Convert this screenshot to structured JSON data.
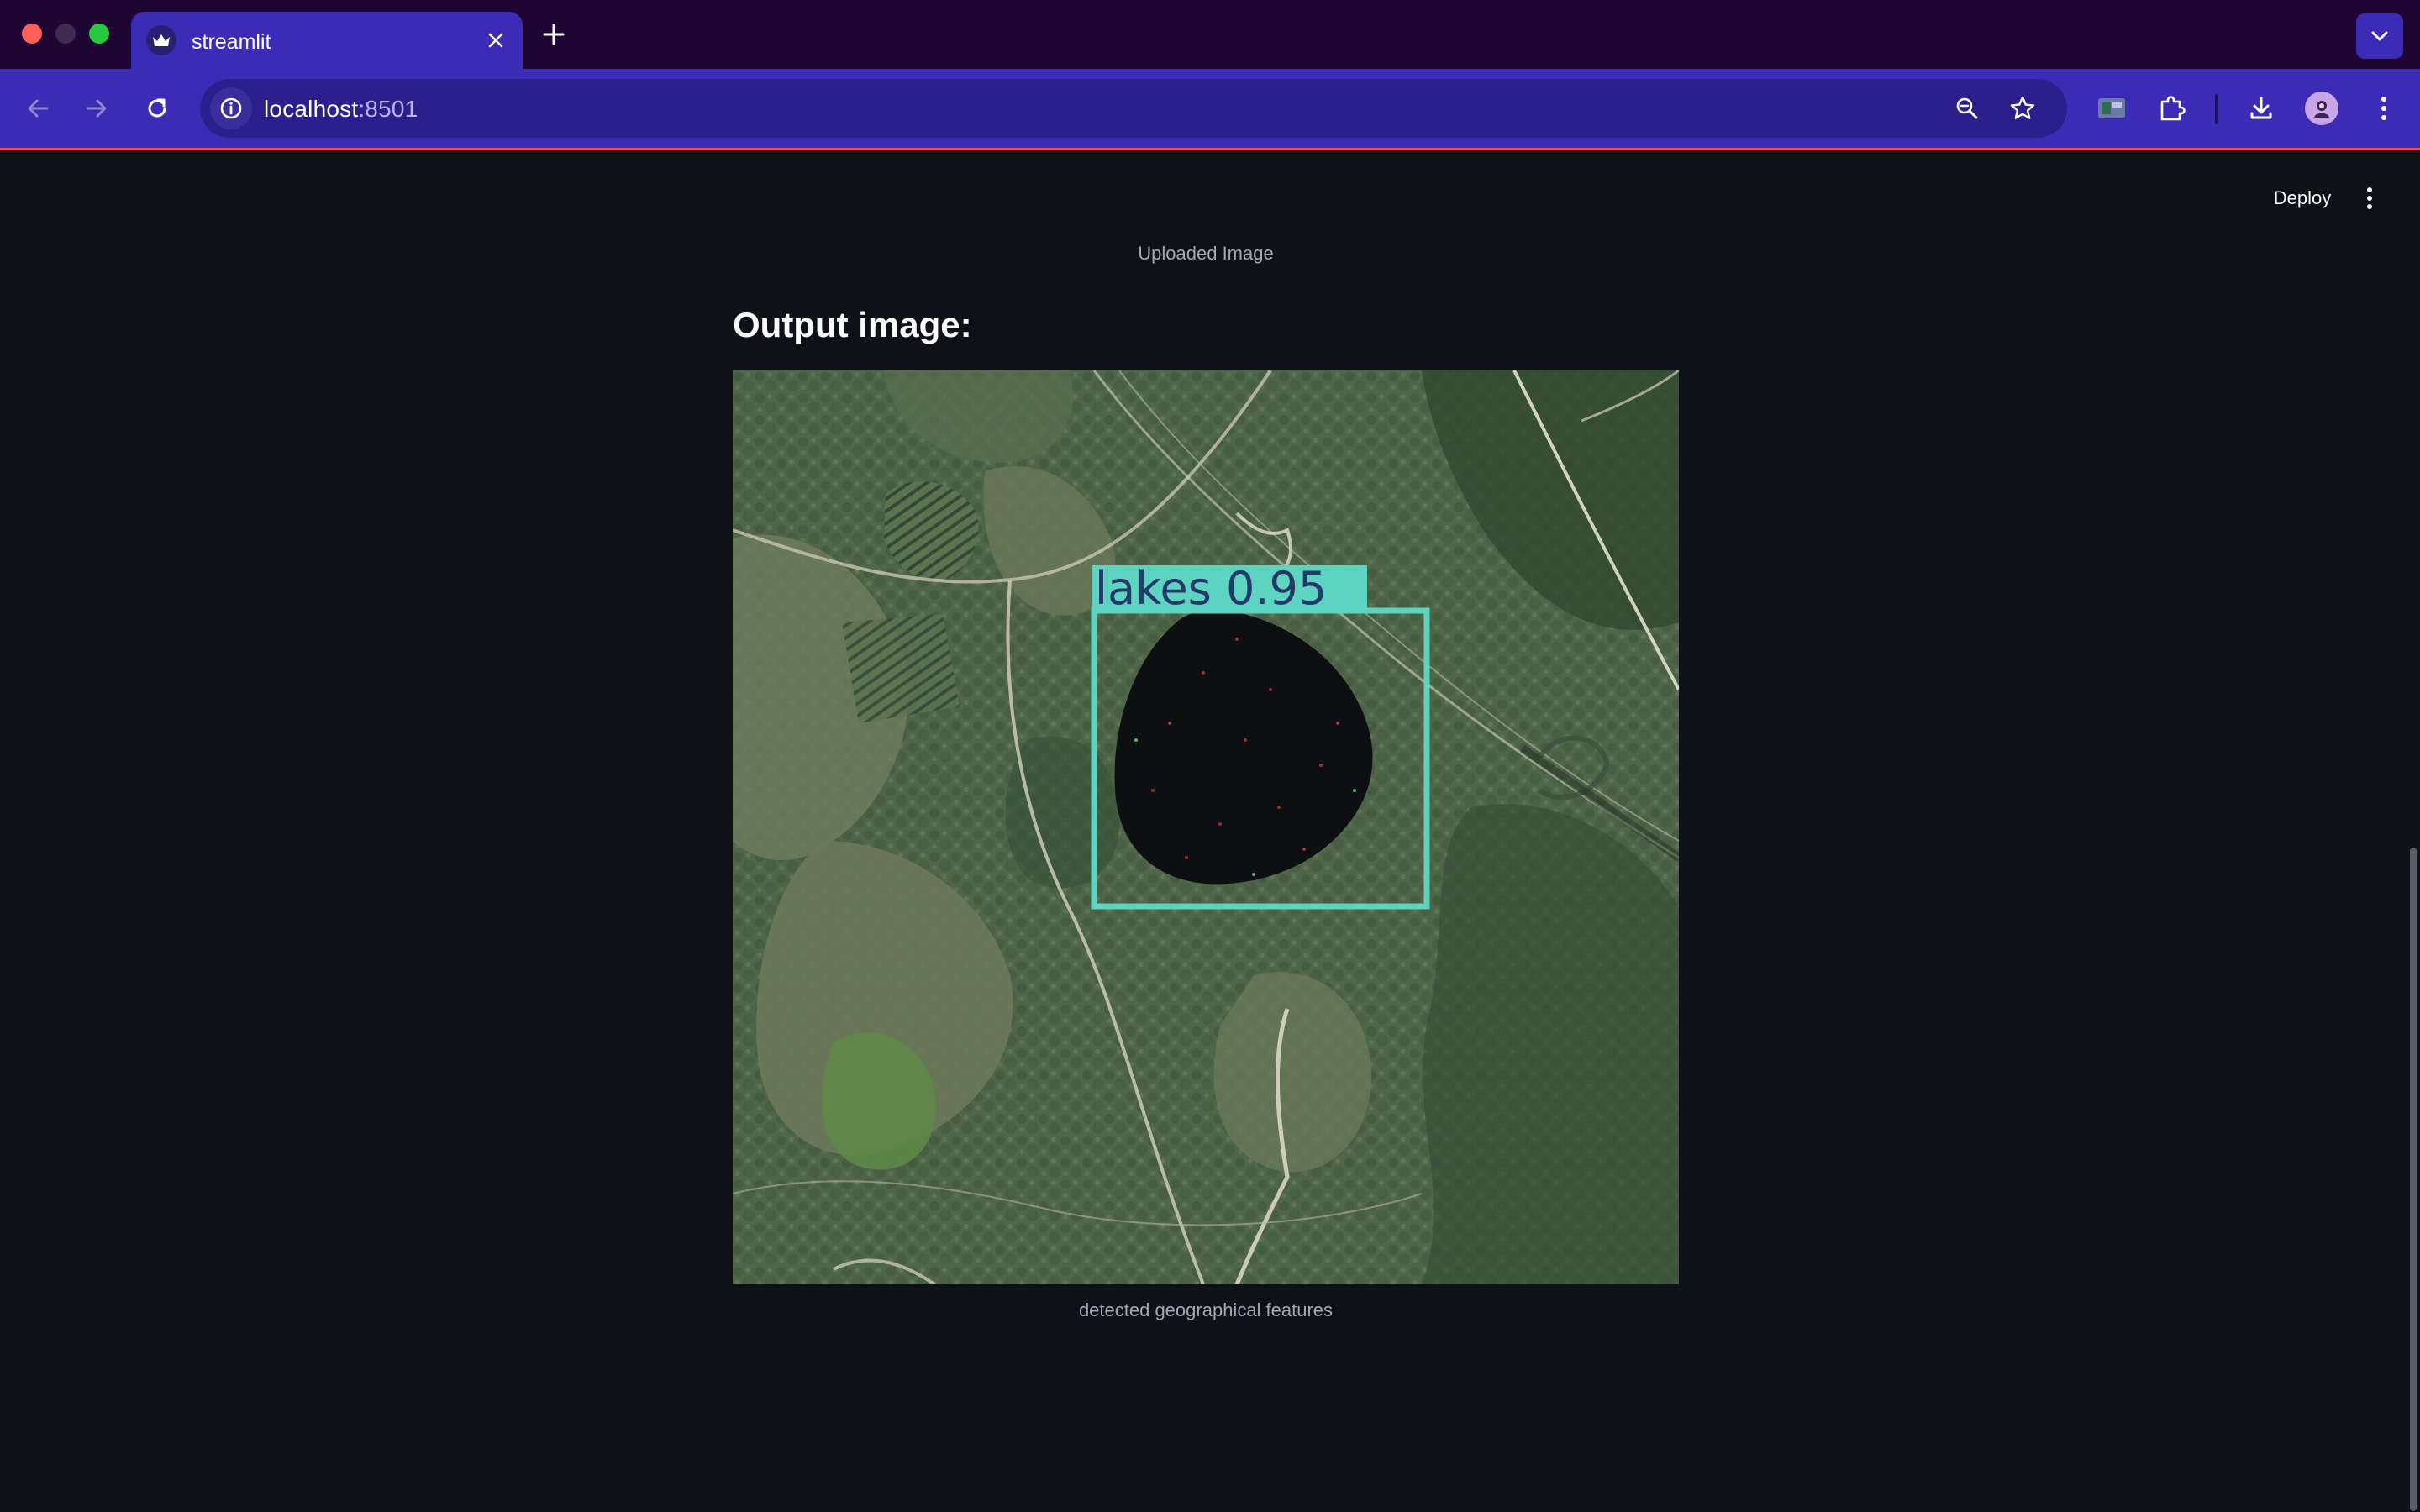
{
  "browser": {
    "tab_title": "streamlit",
    "url_host": "localhost",
    "url_port": ":8501"
  },
  "app": {
    "deploy_label": "Deploy",
    "uploaded_caption": "Uploaded Image",
    "output_heading": "Output image:",
    "output_caption": "detected geographical features",
    "detection": {
      "label": "lakes 0.95",
      "box_color": "#5ed3c0"
    }
  },
  "colors": {
    "tab_bar": "#1f0533",
    "toolbar": "#3c2bb5",
    "app_background": "#0e1117",
    "accent_line": "#ff4b4b"
  }
}
